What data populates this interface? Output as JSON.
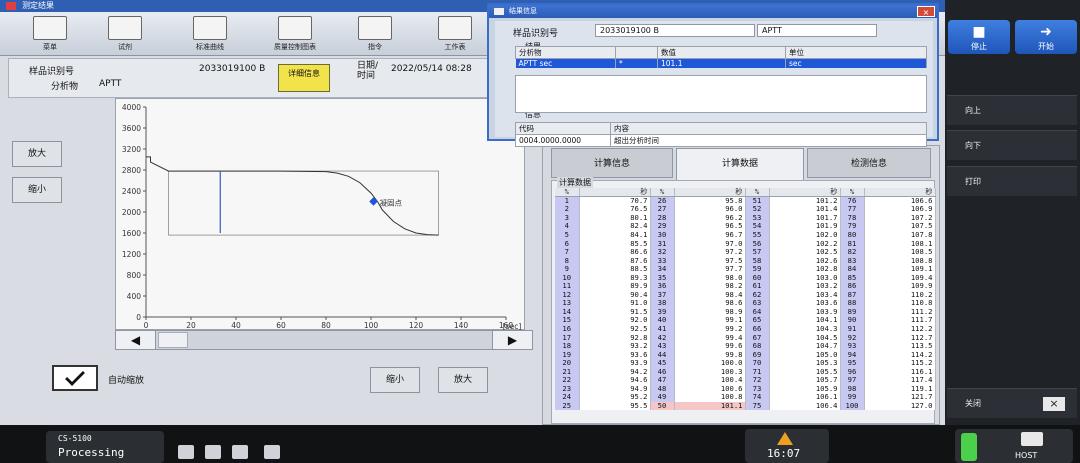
{
  "window": {
    "title": "测定结果"
  },
  "toolbar": [
    {
      "label": "菜单"
    },
    {
      "label": "试剂"
    },
    {
      "label": "标准曲线"
    },
    {
      "label": "质量控制图表"
    },
    {
      "label": "指令"
    },
    {
      "label": "工作表"
    }
  ],
  "sample": {
    "id_label": "样品识别号",
    "id_value": "2033019100 B",
    "detail_button": "详细信息",
    "datetime_label": "日期/时间",
    "datetime_value": "2022/05/14 08:28",
    "analyte_label": "分析物",
    "analyte_value": "APTT"
  },
  "graph": {
    "y_ticks": [
      "4000",
      "3600",
      "3200",
      "2800",
      "2400",
      "2000",
      "1600",
      "1200",
      "800",
      "400",
      "0"
    ],
    "x_ticks": [
      "0",
      "20",
      "40",
      "60",
      "80",
      "100",
      "120",
      "140",
      "160"
    ],
    "x_unit": "[sec]",
    "annotation": "凝固点"
  },
  "chart_data": {
    "type": "line",
    "series": [
      {
        "x": [
          0,
          2,
          2,
          10,
          33,
          60,
          80,
          85,
          90,
          95,
          100,
          103,
          105,
          110,
          115,
          120,
          125,
          130
        ],
        "y": [
          3050,
          3050,
          2950,
          2780,
          2780,
          2780,
          2770,
          2740,
          2680,
          2560,
          2360,
          2190,
          2040,
          1820,
          1680,
          1600,
          1570,
          1560
        ]
      }
    ],
    "spike": {
      "x": 33,
      "y_top": 2780,
      "y_bottom": 1600
    },
    "clot_point": {
      "x": 101.1,
      "y": 2200
    },
    "xlim": [
      0,
      160
    ],
    "ylim": [
      0,
      4000
    ]
  },
  "controls": {
    "zoom_in_side": "放大",
    "zoom_out_side": "缩小",
    "auto_zoom_label": "自动缩放",
    "zoom_out_bottom": "缩小",
    "zoom_in_bottom": "放大",
    "scroll_left": "◀",
    "scroll_right": "▶"
  },
  "tabs": [
    {
      "label": "计算信息"
    },
    {
      "label": "计算数据"
    },
    {
      "label": "检测信息"
    }
  ],
  "calc": {
    "group_title": "计算数据",
    "headers": [
      "%",
      "秒",
      "%",
      "秒",
      "%",
      "秒",
      "%",
      "秒"
    ],
    "rows": [
      [
        "1",
        "70.7",
        "26",
        "95.8",
        "51",
        "101.2",
        "76",
        "106.6"
      ],
      [
        "2",
        "76.5",
        "27",
        "96.0",
        "52",
        "101.4",
        "77",
        "106.9"
      ],
      [
        "3",
        "80.1",
        "28",
        "96.2",
        "53",
        "101.7",
        "78",
        "107.2"
      ],
      [
        "4",
        "82.4",
        "29",
        "96.5",
        "54",
        "101.9",
        "79",
        "107.5"
      ],
      [
        "5",
        "84.1",
        "30",
        "96.7",
        "55",
        "102.0",
        "80",
        "107.8"
      ],
      [
        "6",
        "85.5",
        "31",
        "97.0",
        "56",
        "102.2",
        "81",
        "108.1"
      ],
      [
        "7",
        "86.6",
        "32",
        "97.2",
        "57",
        "102.5",
        "82",
        "108.5"
      ],
      [
        "8",
        "87.6",
        "33",
        "97.5",
        "58",
        "102.6",
        "83",
        "108.8"
      ],
      [
        "9",
        "88.5",
        "34",
        "97.7",
        "59",
        "102.8",
        "84",
        "109.1"
      ],
      [
        "10",
        "89.3",
        "35",
        "98.0",
        "60",
        "103.0",
        "85",
        "109.4"
      ],
      [
        "11",
        "89.9",
        "36",
        "98.2",
        "61",
        "103.2",
        "86",
        "109.9"
      ],
      [
        "12",
        "90.4",
        "37",
        "98.4",
        "62",
        "103.4",
        "87",
        "110.2"
      ],
      [
        "13",
        "91.0",
        "38",
        "98.6",
        "63",
        "103.6",
        "88",
        "110.8"
      ],
      [
        "14",
        "91.5",
        "39",
        "98.9",
        "64",
        "103.9",
        "89",
        "111.2"
      ],
      [
        "15",
        "92.0",
        "40",
        "99.1",
        "65",
        "104.1",
        "90",
        "111.7"
      ],
      [
        "16",
        "92.5",
        "41",
        "99.2",
        "66",
        "104.3",
        "91",
        "112.2"
      ],
      [
        "17",
        "92.8",
        "42",
        "99.4",
        "67",
        "104.5",
        "92",
        "112.7"
      ],
      [
        "18",
        "93.2",
        "43",
        "99.6",
        "68",
        "104.7",
        "93",
        "113.5"
      ],
      [
        "19",
        "93.6",
        "44",
        "99.8",
        "69",
        "105.0",
        "94",
        "114.2"
      ],
      [
        "20",
        "93.9",
        "45",
        "100.0",
        "70",
        "105.3",
        "95",
        "115.2"
      ],
      [
        "21",
        "94.2",
        "46",
        "100.3",
        "71",
        "105.5",
        "96",
        "116.1"
      ],
      [
        "22",
        "94.6",
        "47",
        "100.4",
        "72",
        "105.7",
        "97",
        "117.4"
      ],
      [
        "23",
        "94.9",
        "48",
        "100.6",
        "73",
        "105.9",
        "98",
        "119.1"
      ],
      [
        "24",
        "95.2",
        "49",
        "100.8",
        "74",
        "106.1",
        "99",
        "121.7"
      ],
      [
        "25",
        "95.5",
        "50",
        "101.1",
        "75",
        "106.4",
        "100",
        "127.0"
      ]
    ],
    "highlight": {
      "row": 24,
      "col": 2
    }
  },
  "dialog": {
    "title": "结果信息",
    "close": "×",
    "id_label": "样品识别号",
    "id_value": "2033019100 B",
    "analyte_value": "APTT",
    "result_label": "结果",
    "result_headers": [
      "分析物",
      "",
      "数值",
      "单位"
    ],
    "result_row": [
      "APTT sec",
      "*",
      "101.1",
      "sec"
    ],
    "info_label": "信息",
    "info_headers": [
      "代码",
      "内容"
    ],
    "info_row": [
      "0004.0000.0000",
      "超出分析时间"
    ]
  },
  "right_panel": {
    "stop": "停止",
    "start": "开始",
    "up": "向上",
    "down": "向下",
    "print": "打印",
    "close": "关闭",
    "close_icon": "×"
  },
  "status": {
    "model": "CS-5100",
    "state": "Processing",
    "time": "16:07",
    "host": "HOST"
  }
}
